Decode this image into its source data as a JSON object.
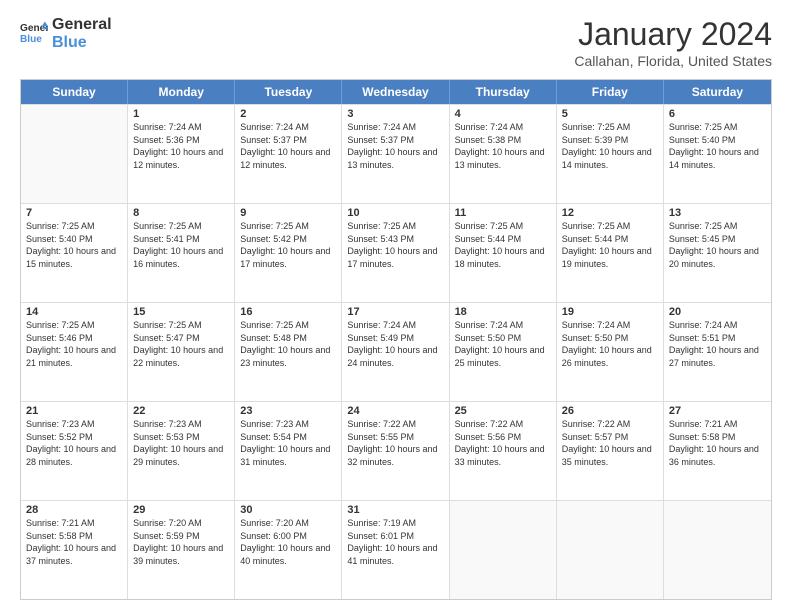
{
  "logo": {
    "line1": "General",
    "line2": "Blue"
  },
  "title": "January 2024",
  "location": "Callahan, Florida, United States",
  "days_of_week": [
    "Sunday",
    "Monday",
    "Tuesday",
    "Wednesday",
    "Thursday",
    "Friday",
    "Saturday"
  ],
  "weeks": [
    [
      {
        "day": null,
        "sunrise": null,
        "sunset": null,
        "daylight": null
      },
      {
        "day": "1",
        "sunrise": "Sunrise: 7:24 AM",
        "sunset": "Sunset: 5:36 PM",
        "daylight": "Daylight: 10 hours and 12 minutes."
      },
      {
        "day": "2",
        "sunrise": "Sunrise: 7:24 AM",
        "sunset": "Sunset: 5:37 PM",
        "daylight": "Daylight: 10 hours and 12 minutes."
      },
      {
        "day": "3",
        "sunrise": "Sunrise: 7:24 AM",
        "sunset": "Sunset: 5:37 PM",
        "daylight": "Daylight: 10 hours and 13 minutes."
      },
      {
        "day": "4",
        "sunrise": "Sunrise: 7:24 AM",
        "sunset": "Sunset: 5:38 PM",
        "daylight": "Daylight: 10 hours and 13 minutes."
      },
      {
        "day": "5",
        "sunrise": "Sunrise: 7:25 AM",
        "sunset": "Sunset: 5:39 PM",
        "daylight": "Daylight: 10 hours and 14 minutes."
      },
      {
        "day": "6",
        "sunrise": "Sunrise: 7:25 AM",
        "sunset": "Sunset: 5:40 PM",
        "daylight": "Daylight: 10 hours and 14 minutes."
      }
    ],
    [
      {
        "day": "7",
        "sunrise": "Sunrise: 7:25 AM",
        "sunset": "Sunset: 5:40 PM",
        "daylight": "Daylight: 10 hours and 15 minutes."
      },
      {
        "day": "8",
        "sunrise": "Sunrise: 7:25 AM",
        "sunset": "Sunset: 5:41 PM",
        "daylight": "Daylight: 10 hours and 16 minutes."
      },
      {
        "day": "9",
        "sunrise": "Sunrise: 7:25 AM",
        "sunset": "Sunset: 5:42 PM",
        "daylight": "Daylight: 10 hours and 17 minutes."
      },
      {
        "day": "10",
        "sunrise": "Sunrise: 7:25 AM",
        "sunset": "Sunset: 5:43 PM",
        "daylight": "Daylight: 10 hours and 17 minutes."
      },
      {
        "day": "11",
        "sunrise": "Sunrise: 7:25 AM",
        "sunset": "Sunset: 5:44 PM",
        "daylight": "Daylight: 10 hours and 18 minutes."
      },
      {
        "day": "12",
        "sunrise": "Sunrise: 7:25 AM",
        "sunset": "Sunset: 5:44 PM",
        "daylight": "Daylight: 10 hours and 19 minutes."
      },
      {
        "day": "13",
        "sunrise": "Sunrise: 7:25 AM",
        "sunset": "Sunset: 5:45 PM",
        "daylight": "Daylight: 10 hours and 20 minutes."
      }
    ],
    [
      {
        "day": "14",
        "sunrise": "Sunrise: 7:25 AM",
        "sunset": "Sunset: 5:46 PM",
        "daylight": "Daylight: 10 hours and 21 minutes."
      },
      {
        "day": "15",
        "sunrise": "Sunrise: 7:25 AM",
        "sunset": "Sunset: 5:47 PM",
        "daylight": "Daylight: 10 hours and 22 minutes."
      },
      {
        "day": "16",
        "sunrise": "Sunrise: 7:25 AM",
        "sunset": "Sunset: 5:48 PM",
        "daylight": "Daylight: 10 hours and 23 minutes."
      },
      {
        "day": "17",
        "sunrise": "Sunrise: 7:24 AM",
        "sunset": "Sunset: 5:49 PM",
        "daylight": "Daylight: 10 hours and 24 minutes."
      },
      {
        "day": "18",
        "sunrise": "Sunrise: 7:24 AM",
        "sunset": "Sunset: 5:50 PM",
        "daylight": "Daylight: 10 hours and 25 minutes."
      },
      {
        "day": "19",
        "sunrise": "Sunrise: 7:24 AM",
        "sunset": "Sunset: 5:50 PM",
        "daylight": "Daylight: 10 hours and 26 minutes."
      },
      {
        "day": "20",
        "sunrise": "Sunrise: 7:24 AM",
        "sunset": "Sunset: 5:51 PM",
        "daylight": "Daylight: 10 hours and 27 minutes."
      }
    ],
    [
      {
        "day": "21",
        "sunrise": "Sunrise: 7:23 AM",
        "sunset": "Sunset: 5:52 PM",
        "daylight": "Daylight: 10 hours and 28 minutes."
      },
      {
        "day": "22",
        "sunrise": "Sunrise: 7:23 AM",
        "sunset": "Sunset: 5:53 PM",
        "daylight": "Daylight: 10 hours and 29 minutes."
      },
      {
        "day": "23",
        "sunrise": "Sunrise: 7:23 AM",
        "sunset": "Sunset: 5:54 PM",
        "daylight": "Daylight: 10 hours and 31 minutes."
      },
      {
        "day": "24",
        "sunrise": "Sunrise: 7:22 AM",
        "sunset": "Sunset: 5:55 PM",
        "daylight": "Daylight: 10 hours and 32 minutes."
      },
      {
        "day": "25",
        "sunrise": "Sunrise: 7:22 AM",
        "sunset": "Sunset: 5:56 PM",
        "daylight": "Daylight: 10 hours and 33 minutes."
      },
      {
        "day": "26",
        "sunrise": "Sunrise: 7:22 AM",
        "sunset": "Sunset: 5:57 PM",
        "daylight": "Daylight: 10 hours and 35 minutes."
      },
      {
        "day": "27",
        "sunrise": "Sunrise: 7:21 AM",
        "sunset": "Sunset: 5:58 PM",
        "daylight": "Daylight: 10 hours and 36 minutes."
      }
    ],
    [
      {
        "day": "28",
        "sunrise": "Sunrise: 7:21 AM",
        "sunset": "Sunset: 5:58 PM",
        "daylight": "Daylight: 10 hours and 37 minutes."
      },
      {
        "day": "29",
        "sunrise": "Sunrise: 7:20 AM",
        "sunset": "Sunset: 5:59 PM",
        "daylight": "Daylight: 10 hours and 39 minutes."
      },
      {
        "day": "30",
        "sunrise": "Sunrise: 7:20 AM",
        "sunset": "Sunset: 6:00 PM",
        "daylight": "Daylight: 10 hours and 40 minutes."
      },
      {
        "day": "31",
        "sunrise": "Sunrise: 7:19 AM",
        "sunset": "Sunset: 6:01 PM",
        "daylight": "Daylight: 10 hours and 41 minutes."
      },
      {
        "day": null,
        "sunrise": null,
        "sunset": null,
        "daylight": null
      },
      {
        "day": null,
        "sunrise": null,
        "sunset": null,
        "daylight": null
      },
      {
        "day": null,
        "sunrise": null,
        "sunset": null,
        "daylight": null
      }
    ]
  ]
}
